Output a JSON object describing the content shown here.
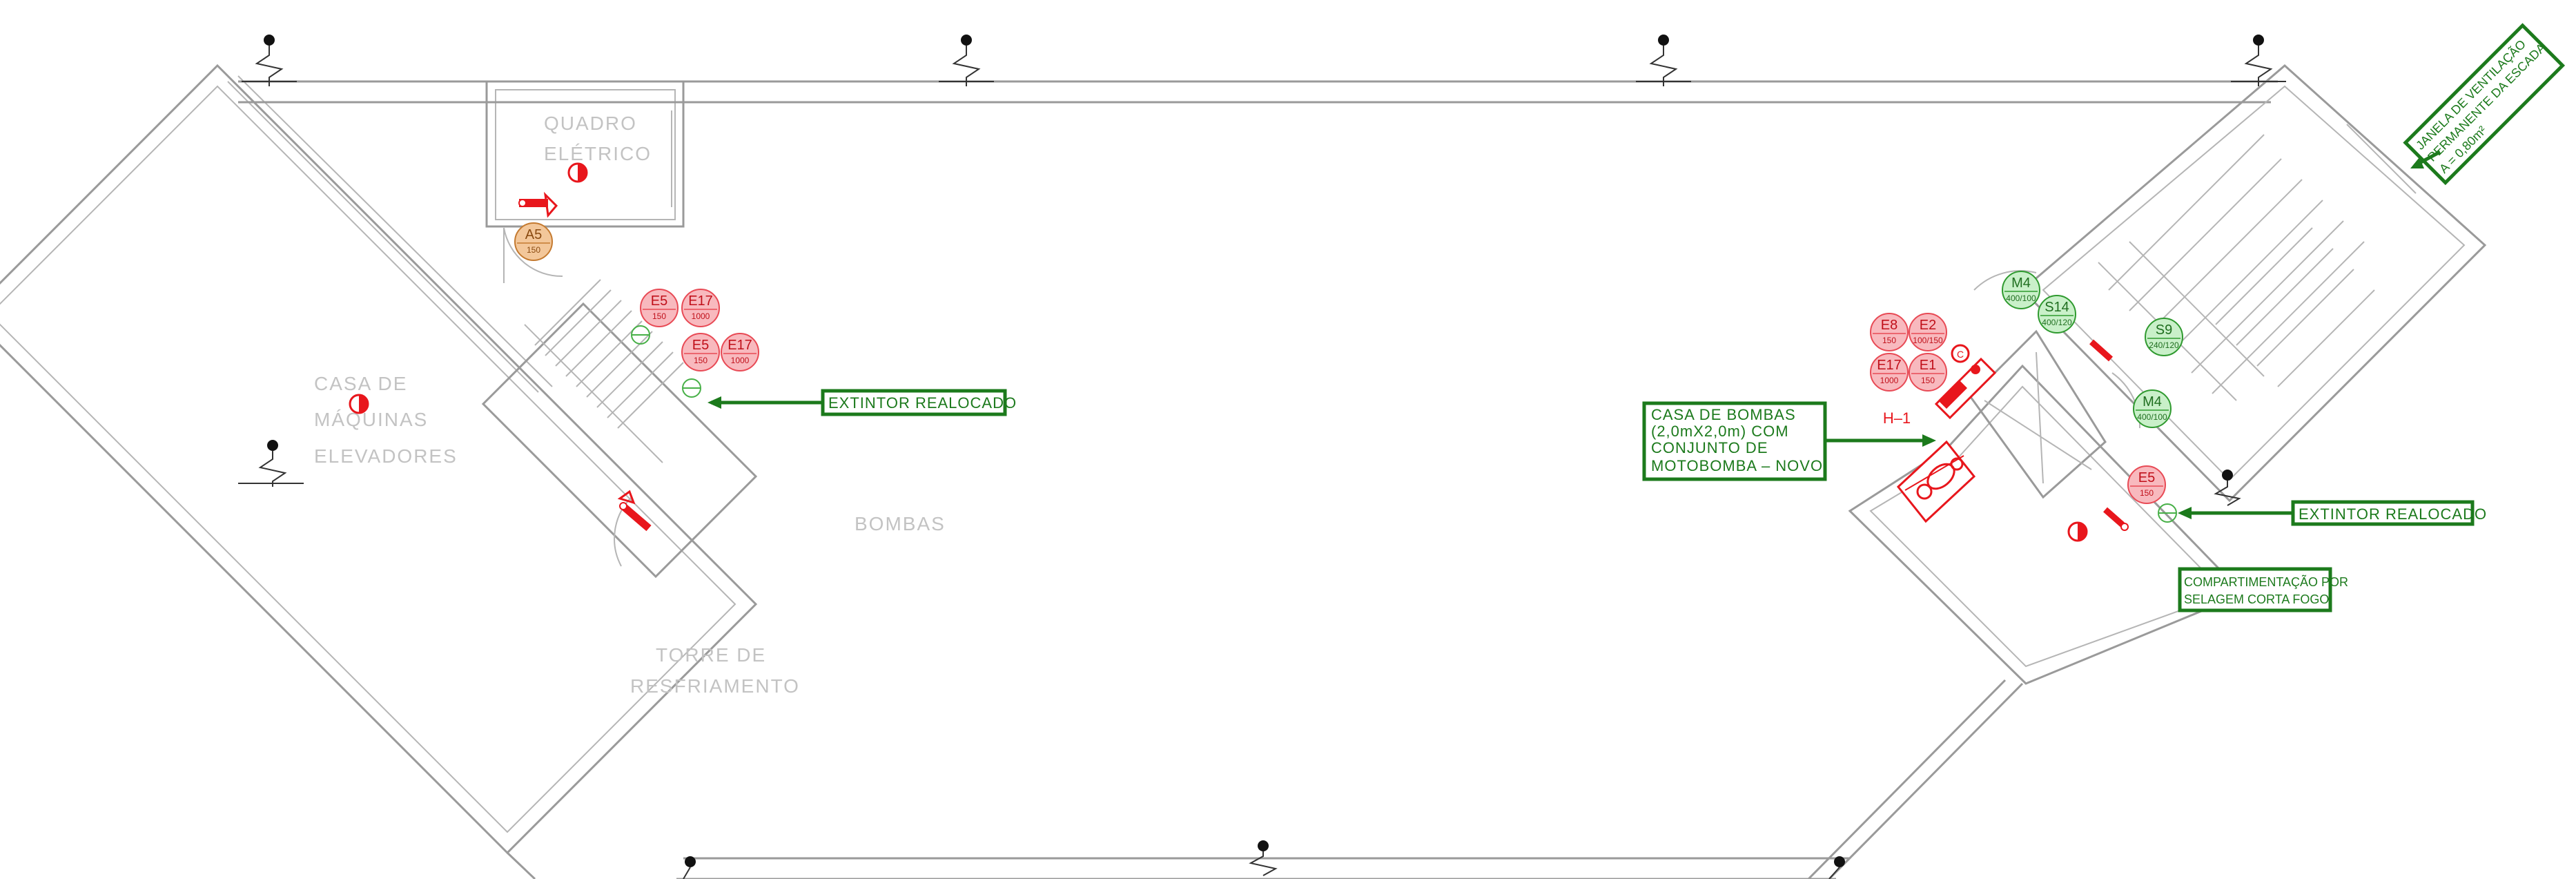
{
  "rooms": {
    "quadro_eletrico": [
      "QUADRO",
      "ELÉTRICO"
    ],
    "casa_maquinas": [
      "CASA  DE",
      "MÁQUINAS",
      "ELEVADORES"
    ],
    "bombas": "BOMBAS",
    "torre": [
      "TORRE  DE",
      "RESFRIAMENTO"
    ]
  },
  "callouts": {
    "extintor_left": "EXTINTOR  REALOCADO",
    "extintor_right": "EXTINTOR  REALOCADO",
    "casa_bombas": [
      "CASA  DE  BOMBAS",
      "(2,0mX2,0m)  COM",
      "CONJUNTO  DE",
      "MOTOBOMBA  –  NOVO"
    ],
    "compartimentacao": [
      "COMPARTIMENTAÇÃO  POR",
      "SELAGEM CORTA FOGO"
    ],
    "janela": [
      "JANELA  DE  VENTILAÇÃO",
      "PERMANENTE  DA  ESCADA",
      "A  =  0,80m²"
    ]
  },
  "hydrant_label": "H–1",
  "badges": [
    {
      "id": "a5",
      "code": "A5",
      "cap": "150",
      "color": "orange"
    },
    {
      "id": "e5-a",
      "code": "E5",
      "cap": "150",
      "color": "red"
    },
    {
      "id": "e17-a",
      "code": "E17",
      "cap": "1000",
      "color": "red"
    },
    {
      "id": "e5-b",
      "code": "E5",
      "cap": "150",
      "color": "red"
    },
    {
      "id": "e17-b",
      "code": "E17",
      "cap": "1000",
      "color": "red"
    },
    {
      "id": "e8",
      "code": "E8",
      "cap": "150",
      "color": "red"
    },
    {
      "id": "e2",
      "code": "E2",
      "cap": "100/150",
      "color": "red"
    },
    {
      "id": "e17-c",
      "code": "E17",
      "cap": "1000",
      "color": "red"
    },
    {
      "id": "e1",
      "code": "E1",
      "cap": "150",
      "color": "red"
    },
    {
      "id": "e5-c",
      "code": "E5",
      "cap": "150",
      "color": "red"
    },
    {
      "id": "m4-a",
      "code": "M4",
      "cap": "400/100",
      "color": "green"
    },
    {
      "id": "s14",
      "code": "S14",
      "cap": "400/120",
      "color": "green"
    },
    {
      "id": "s9",
      "code": "S9",
      "cap": "240/120",
      "color": "green"
    },
    {
      "id": "m4-b",
      "code": "M4",
      "cap": "400/100",
      "color": "green"
    }
  ],
  "colors": {
    "wall": "#9a9a9a",
    "callout_green": "#1c7a1c",
    "signage_red": "#e8161c",
    "badge_red_fill": "#f8b9be",
    "badge_red_stroke": "#e84a55",
    "badge_green_fill": "#c9f0c9",
    "badge_green_stroke": "#2f9a2f",
    "badge_orange_fill": "#f3c79a",
    "badge_orange_stroke": "#c47a30"
  }
}
